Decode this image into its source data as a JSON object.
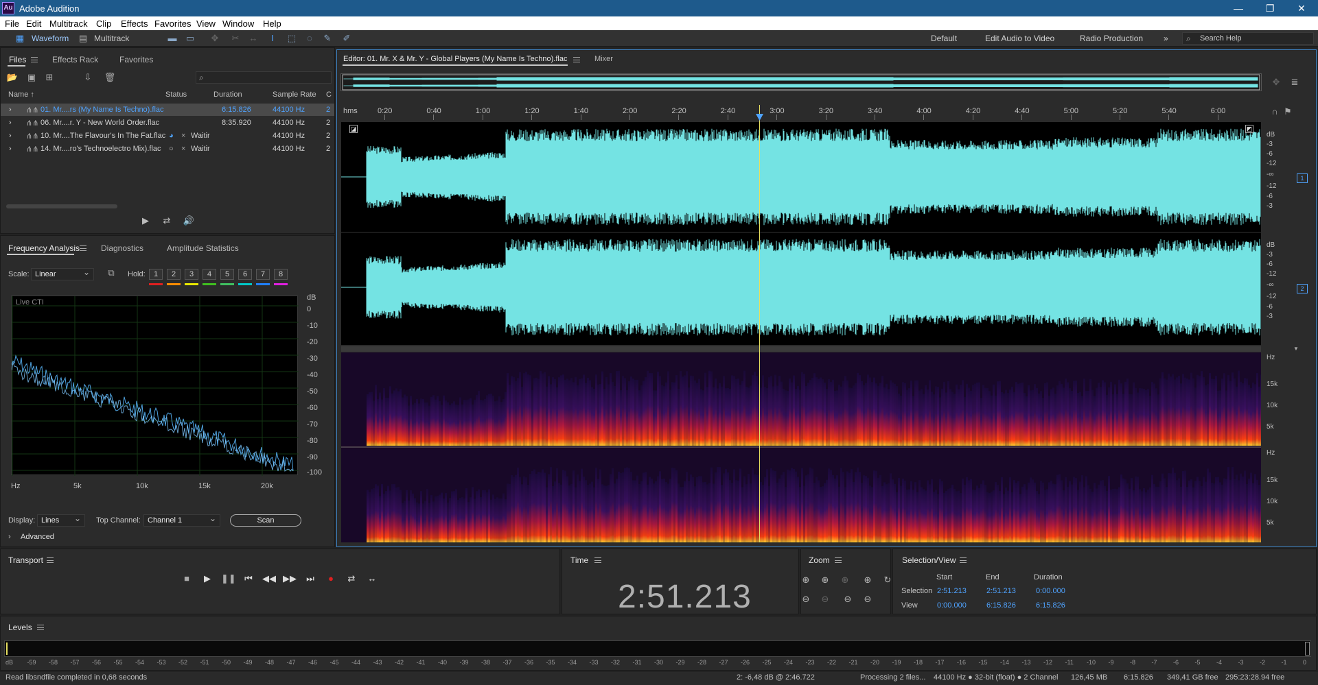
{
  "app": {
    "title": "Adobe Audition",
    "logo": "Au"
  },
  "menu": [
    "File",
    "Edit",
    "Multitrack",
    "Clip",
    "Effects",
    "Favorites",
    "View",
    "Window",
    "Help"
  ],
  "toolbar": {
    "waveform": "Waveform",
    "multitrack": "Multitrack",
    "workspaces": [
      "Default",
      "Edit Audio to Video",
      "Radio Production"
    ],
    "search_label": "Search Help"
  },
  "files_panel": {
    "tabs": [
      "Files",
      "Effects Rack",
      "Favorites"
    ],
    "columns": [
      "Name",
      "Status",
      "Duration",
      "Sample Rate",
      "C"
    ],
    "rows": [
      {
        "name": "01. Mr....rs (My Name Is Techno).flac",
        "status": "",
        "duration": "6:15.826",
        "rate": "44100 Hz",
        "c": "2"
      },
      {
        "name": "06. Mr....r. Y - New World Order.flac",
        "status": "",
        "duration": "8:35.920",
        "rate": "44100 Hz",
        "c": "2"
      },
      {
        "name": "10. Mr....The Flavour's In The Fat.flac",
        "status": "Waitir",
        "duration": "",
        "rate": "44100 Hz",
        "c": "2"
      },
      {
        "name": "14. Mr....ro's Technoelectro Mix).flac",
        "status": "Waitir",
        "duration": "",
        "rate": "44100 Hz",
        "c": "2"
      }
    ]
  },
  "freq_panel": {
    "tabs": [
      "Frequency Analysis",
      "Diagnostics",
      "Amplitude Statistics"
    ],
    "scale_label": "Scale:",
    "scale_value": "Linear",
    "hold_label": "Hold:",
    "holds": [
      "1",
      "2",
      "3",
      "4",
      "5",
      "6",
      "7",
      "8"
    ],
    "hold_colors": [
      "#e02020",
      "#ff8c00",
      "#e8e800",
      "#40c020",
      "#40c060",
      "#00c8c8",
      "#2080ff",
      "#e020e0"
    ],
    "live_label": "Live CTI",
    "db_unit": "dB",
    "y_ticks": [
      "0",
      "-10",
      "-20",
      "-30",
      "-40",
      "-50",
      "-60",
      "-70",
      "-80",
      "-90",
      "-100"
    ],
    "x_ticks": [
      "Hz",
      "5k",
      "10k",
      "15k",
      "20k"
    ],
    "display_label": "Display:",
    "display_value": "Lines",
    "top_channel_label": "Top Channel:",
    "top_channel_value": "Channel 1",
    "scan": "Scan",
    "advanced": "Advanced"
  },
  "editor": {
    "tab": "Editor: 01. Mr. X & Mr. Y - Global Players (My Name Is Techno).flac",
    "mixer": "Mixer",
    "time_unit": "hms",
    "time_ticks": [
      "0:20",
      "0:40",
      "1:00",
      "1:20",
      "1:40",
      "2:00",
      "2:20",
      "2:40",
      "3:00",
      "3:20",
      "3:40",
      "4:00",
      "4:20",
      "4:40",
      "5:00",
      "5:20",
      "5:40",
      "6:00"
    ],
    "db_scale": [
      "dB",
      "-3",
      "-6",
      "-12",
      "-∞",
      "-12",
      "-6",
      "-3"
    ],
    "channels": [
      "1",
      "2"
    ],
    "hz_unit": "Hz",
    "hz_scale": [
      "15k",
      "10k",
      "5k"
    ],
    "waveform_color": "#74e3e3",
    "playhead_color": "#e8e060"
  },
  "transport": {
    "title": "Transport"
  },
  "time": {
    "title": "Time",
    "value": "2:51.213"
  },
  "zoom": {
    "title": "Zoom"
  },
  "selection": {
    "title": "Selection/View",
    "cols": [
      "Start",
      "End",
      "Duration"
    ],
    "selection_label": "Selection",
    "view_label": "View",
    "sel": [
      "2:51.213",
      "2:51.213",
      "0:00.000"
    ],
    "view": [
      "0:00.000",
      "6:15.826",
      "6:15.826"
    ]
  },
  "levels": {
    "title": "Levels",
    "ticks": [
      "dB",
      "-59",
      "-58",
      "-57",
      "-56",
      "-55",
      "-54",
      "-53",
      "-52",
      "-51",
      "-50",
      "-49",
      "-48",
      "-47",
      "-46",
      "-45",
      "-44",
      "-43",
      "-42",
      "-41",
      "-40",
      "-39",
      "-38",
      "-37",
      "-36",
      "-35",
      "-34",
      "-33",
      "-32",
      "-31",
      "-30",
      "-29",
      "-28",
      "-27",
      "-26",
      "-25",
      "-24",
      "-23",
      "-22",
      "-21",
      "-20",
      "-19",
      "-18",
      "-17",
      "-16",
      "-15",
      "-14",
      "-13",
      "-12",
      "-11",
      "-10",
      "-9",
      "-8",
      "-7",
      "-6",
      "-5",
      "-4",
      "-3",
      "-2",
      "-1",
      "0"
    ]
  },
  "status": {
    "message": "Read libsndfile completed in 0,68 seconds",
    "cursor": "2: -6,48 dB @ 2:46.722",
    "processing": "Processing 2 files...",
    "format": "44100 Hz ● 32-bit (float) ● 2 Channel",
    "size": "126,45 MB",
    "duration": "6:15.826",
    "free": "349,41 GB free",
    "free_time": "295:23:28.94 free"
  }
}
